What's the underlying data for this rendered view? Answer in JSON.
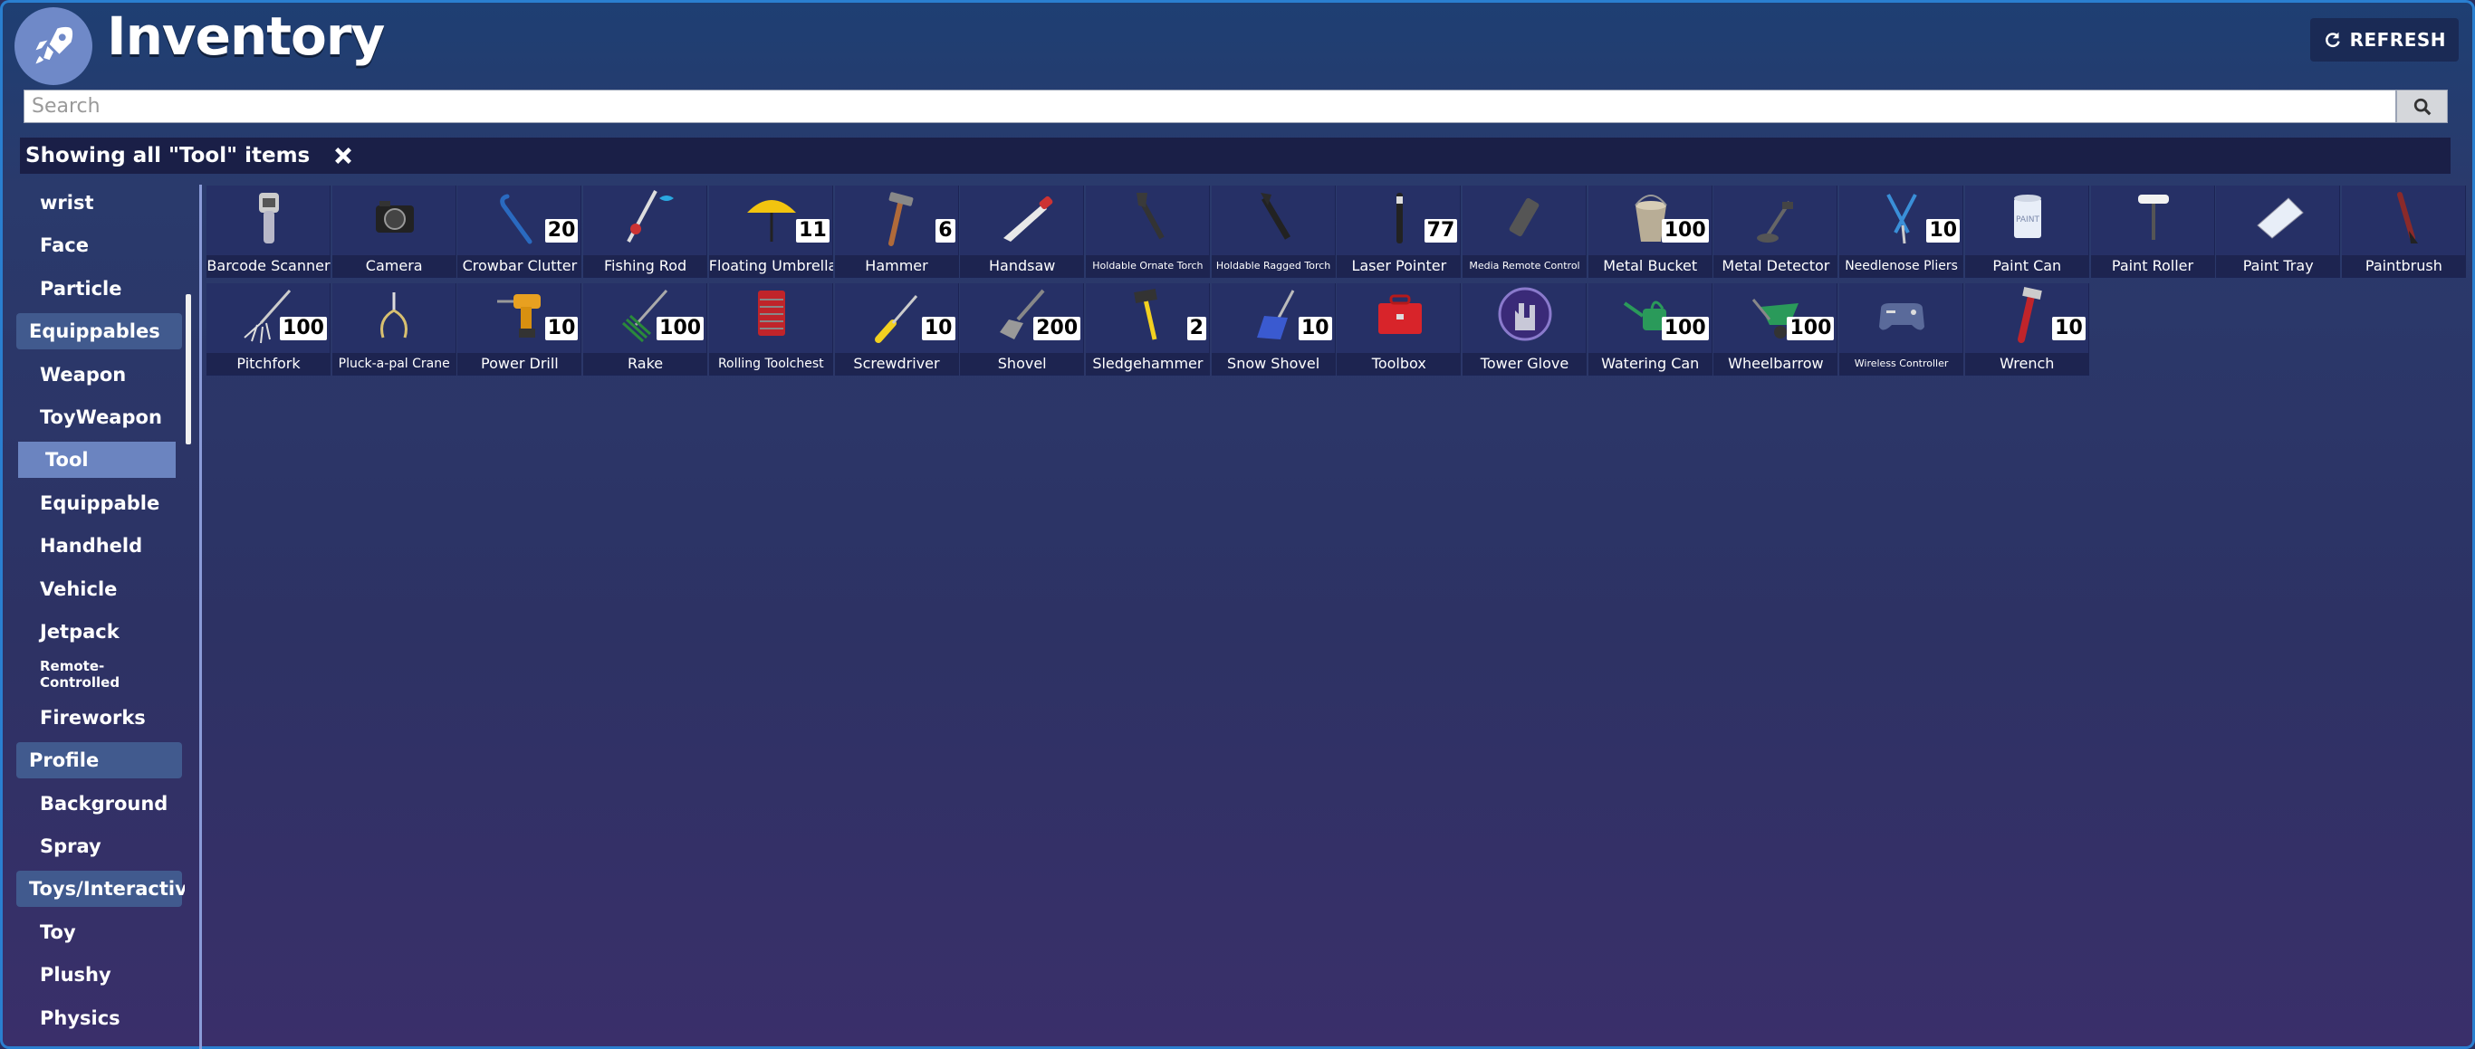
{
  "header": {
    "title": "Inventory",
    "refresh_label": "REFRESH"
  },
  "search": {
    "placeholder": "Search",
    "value": ""
  },
  "filter": {
    "text": "Showing all \"Tool\" items"
  },
  "sidebar": {
    "items": [
      {
        "label": "wrist",
        "kind": "sub"
      },
      {
        "label": "Face",
        "kind": "sub"
      },
      {
        "label": "Particle",
        "kind": "sub"
      },
      {
        "label": "Equippables",
        "kind": "cat"
      },
      {
        "label": "Weapon",
        "kind": "sub"
      },
      {
        "label": "ToyWeapon",
        "kind": "sub"
      },
      {
        "label": "Tool",
        "kind": "sub",
        "active": true
      },
      {
        "label": "Equippable",
        "kind": "sub"
      },
      {
        "label": "Handheld",
        "kind": "sub"
      },
      {
        "label": "Vehicle",
        "kind": "sub"
      },
      {
        "label": "Jetpack",
        "kind": "sub"
      },
      {
        "label": "Remote-Controlled",
        "kind": "sub",
        "small": true
      },
      {
        "label": "Fireworks",
        "kind": "sub"
      },
      {
        "label": "Profile",
        "kind": "cat"
      },
      {
        "label": "Background",
        "kind": "sub"
      },
      {
        "label": "Spray",
        "kind": "sub"
      },
      {
        "label": "Toys/Interactive",
        "kind": "cat"
      },
      {
        "label": "Toy",
        "kind": "sub"
      },
      {
        "label": "Plushy",
        "kind": "sub"
      },
      {
        "label": "Physics",
        "kind": "sub"
      }
    ]
  },
  "items": [
    {
      "name": "Barcode Scanner",
      "count": "",
      "icon": "barcode-scanner-icon"
    },
    {
      "name": "Camera",
      "count": "",
      "icon": "camera-icon"
    },
    {
      "name": "Crowbar Clutter",
      "count": "20",
      "icon": "crowbar-icon"
    },
    {
      "name": "Fishing Rod",
      "count": "",
      "icon": "fishing-rod-icon"
    },
    {
      "name": "Floating Umbrella",
      "count": "11",
      "icon": "umbrella-icon"
    },
    {
      "name": "Hammer",
      "count": "6",
      "icon": "hammer-icon"
    },
    {
      "name": "Handsaw",
      "count": "",
      "icon": "handsaw-icon"
    },
    {
      "name": "Holdable Ornate Torch",
      "count": "",
      "icon": "ornate-torch-icon",
      "tiny": true
    },
    {
      "name": "Holdable Ragged Torch",
      "count": "",
      "icon": "ragged-torch-icon",
      "tiny": true
    },
    {
      "name": "Laser Pointer",
      "count": "77",
      "icon": "laser-pointer-icon"
    },
    {
      "name": "Media Remote Control",
      "count": "",
      "icon": "remote-control-icon",
      "tiny": true
    },
    {
      "name": "Metal Bucket",
      "count": "100",
      "icon": "bucket-icon"
    },
    {
      "name": "Metal Detector",
      "count": "",
      "icon": "metal-detector-icon"
    },
    {
      "name": "Needlenose Pliers",
      "count": "10",
      "icon": "pliers-icon",
      "small": true
    },
    {
      "name": "Paint Can",
      "count": "",
      "icon": "paint-can-icon"
    },
    {
      "name": "Paint Roller",
      "count": "",
      "icon": "paint-roller-icon"
    },
    {
      "name": "Paint Tray",
      "count": "",
      "icon": "paint-tray-icon"
    },
    {
      "name": "Paintbrush",
      "count": "",
      "icon": "paintbrush-icon"
    },
    {
      "name": "Pitchfork",
      "count": "100",
      "icon": "pitchfork-icon"
    },
    {
      "name": "Pluck-a-pal Crane",
      "count": "",
      "icon": "crane-icon",
      "small": true
    },
    {
      "name": "Power Drill",
      "count": "10",
      "icon": "power-drill-icon"
    },
    {
      "name": "Rake",
      "count": "100",
      "icon": "rake-icon"
    },
    {
      "name": "Rolling Toolchest",
      "count": "",
      "icon": "toolchest-icon",
      "small": true
    },
    {
      "name": "Screwdriver",
      "count": "10",
      "icon": "screwdriver-icon"
    },
    {
      "name": "Shovel",
      "count": "200",
      "icon": "shovel-icon"
    },
    {
      "name": "Sledgehammer",
      "count": "2",
      "icon": "sledgehammer-icon"
    },
    {
      "name": "Snow Shovel",
      "count": "10",
      "icon": "snow-shovel-icon"
    },
    {
      "name": "Toolbox",
      "count": "",
      "icon": "toolbox-icon"
    },
    {
      "name": "Tower Glove",
      "count": "",
      "icon": "tower-glove-icon"
    },
    {
      "name": "Watering Can",
      "count": "100",
      "icon": "watering-can-icon"
    },
    {
      "name": "Wheelbarrow",
      "count": "100",
      "icon": "wheelbarrow-icon"
    },
    {
      "name": "Wireless Controller",
      "count": "",
      "icon": "controller-icon",
      "tiny": true
    },
    {
      "name": "Wrench",
      "count": "10",
      "icon": "wrench-icon"
    }
  ]
}
